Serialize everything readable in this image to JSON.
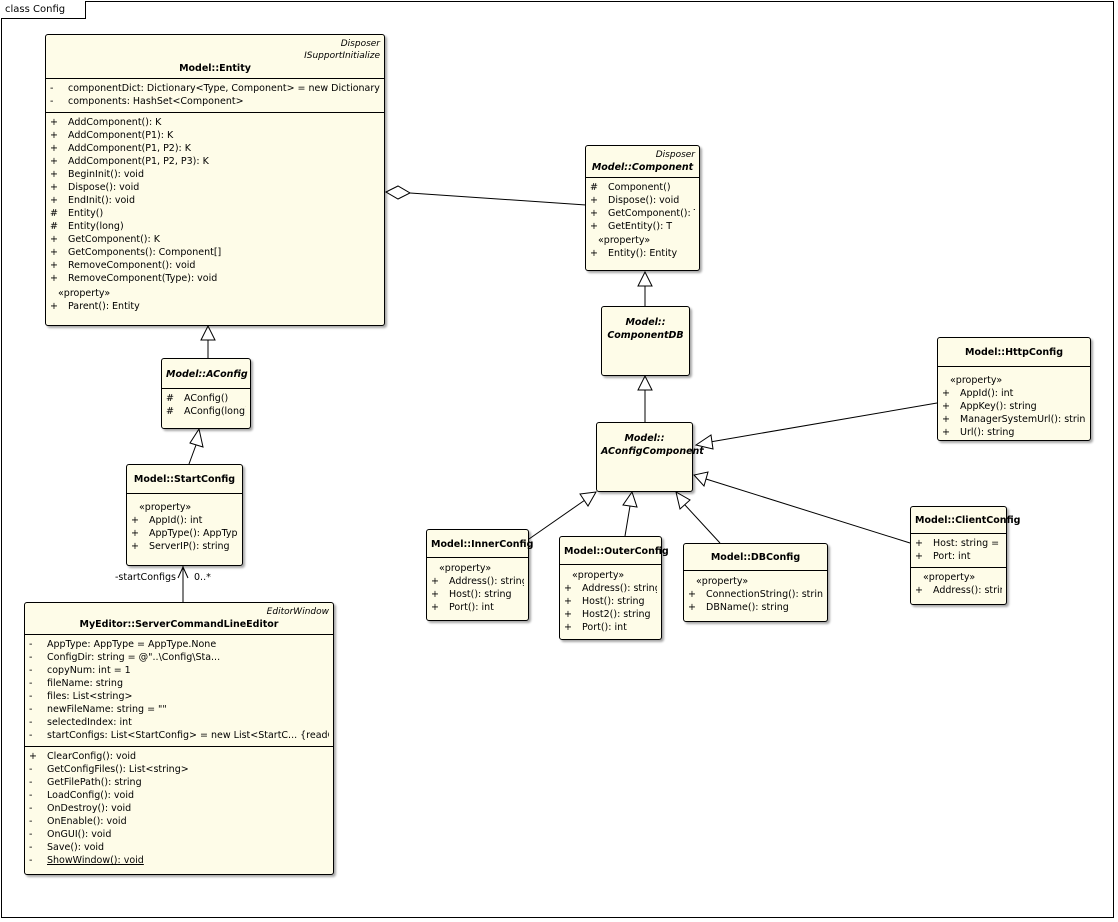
{
  "frame": {
    "label": "class Config"
  },
  "classes": {
    "entity": {
      "stereotypes": [
        "Disposer",
        "ISupportInitialize"
      ],
      "name": "Model::Entity",
      "attributes": [
        {
          "vis": "-",
          "text": "componentDict: Dictionary<Type, Component> = new Dictionary<..."
        },
        {
          "vis": "-",
          "text": "components: HashSet<Component>"
        }
      ],
      "operations": [
        {
          "vis": "+",
          "text": "AddComponent(): K"
        },
        {
          "vis": "+",
          "text": "AddComponent(P1): K"
        },
        {
          "vis": "+",
          "text": "AddComponent(P1, P2): K"
        },
        {
          "vis": "+",
          "text": "AddComponent(P1, P2, P3): K"
        },
        {
          "vis": "+",
          "text": "BeginInit(): void"
        },
        {
          "vis": "+",
          "text": "Dispose(): void"
        },
        {
          "vis": "+",
          "text": "EndInit(): void"
        },
        {
          "vis": "#",
          "text": "Entity()"
        },
        {
          "vis": "#",
          "text": "Entity(long)"
        },
        {
          "vis": "+",
          "text": "GetComponent(): K"
        },
        {
          "vis": "+",
          "text": "GetComponents(): Component[]"
        },
        {
          "vis": "+",
          "text": "RemoveComponent(): void"
        },
        {
          "vis": "+",
          "text": "RemoveComponent(Type): void"
        }
      ],
      "property_label": "«property»",
      "properties": [
        {
          "vis": "+",
          "text": "Parent(): Entity"
        }
      ]
    },
    "component": {
      "stereotypes": [
        "Disposer"
      ],
      "name": "Model::Component",
      "operations": [
        {
          "vis": "#",
          "text": "Component()"
        },
        {
          "vis": "+",
          "text": "Dispose(): void"
        },
        {
          "vis": "+",
          "text": "GetComponent(): T"
        },
        {
          "vis": "+",
          "text": "GetEntity(): T"
        }
      ],
      "property_label": "«property»",
      "properties": [
        {
          "vis": "+",
          "text": "Entity(): Entity"
        }
      ]
    },
    "componentdb": {
      "name_line1": "Model::",
      "name_line2": "ComponentDB"
    },
    "aconfigcomponent": {
      "name_line1": "Model::",
      "name_line2": "AConfigComponent"
    },
    "aconfig": {
      "name": "Model::AConfig",
      "operations": [
        {
          "vis": "#",
          "text": "AConfig()"
        },
        {
          "vis": "#",
          "text": "AConfig(long)"
        }
      ]
    },
    "startconfig": {
      "name": "Model::StartConfig",
      "property_label": "«property»",
      "properties": [
        {
          "vis": "+",
          "text": "AppId(): int"
        },
        {
          "vis": "+",
          "text": "AppType(): AppType"
        },
        {
          "vis": "+",
          "text": "ServerIP(): string"
        }
      ]
    },
    "editor": {
      "stereotypes": [
        "EditorWindow"
      ],
      "name": "MyEditor::ServerCommandLineEditor",
      "attributes": [
        {
          "vis": "-",
          "text": "AppType: AppType = AppType.None"
        },
        {
          "vis": "-",
          "text": "ConfigDir: string = @\"..\\Config\\Sta..."
        },
        {
          "vis": "-",
          "text": "copyNum: int = 1"
        },
        {
          "vis": "-",
          "text": "fileName: string"
        },
        {
          "vis": "-",
          "text": "files: List<string>"
        },
        {
          "vis": "-",
          "text": "newFileName: string = \"\""
        },
        {
          "vis": "-",
          "text": "selectedIndex: int"
        },
        {
          "vis": "-",
          "text": "startConfigs: List<StartConfig> = new List<StartC... {readOnly}"
        }
      ],
      "operations": [
        {
          "vis": "+",
          "text": "ClearConfig(): void"
        },
        {
          "vis": "-",
          "text": "GetConfigFiles(): List<string>"
        },
        {
          "vis": "-",
          "text": "GetFilePath(): string"
        },
        {
          "vis": "-",
          "text": "LoadConfig(): void"
        },
        {
          "vis": "-",
          "text": "OnDestroy(): void"
        },
        {
          "vis": "-",
          "text": "OnEnable(): void"
        },
        {
          "vis": "-",
          "text": "OnGUI(): void"
        },
        {
          "vis": "-",
          "text": "Save(): void"
        },
        {
          "vis": "-",
          "text": "ShowWindow(): void",
          "static": true
        }
      ]
    },
    "httpconfig": {
      "name": "Model::HttpConfig",
      "property_label": "«property»",
      "properties": [
        {
          "vis": "+",
          "text": "AppId(): int"
        },
        {
          "vis": "+",
          "text": "AppKey(): string"
        },
        {
          "vis": "+",
          "text": "ManagerSystemUrl(): string"
        },
        {
          "vis": "+",
          "text": "Url(): string"
        }
      ]
    },
    "innerconfig": {
      "name": "Model::InnerConfig",
      "property_label": "«property»",
      "properties": [
        {
          "vis": "+",
          "text": "Address(): string"
        },
        {
          "vis": "+",
          "text": "Host(): string"
        },
        {
          "vis": "+",
          "text": "Port(): int"
        }
      ]
    },
    "outerconfig": {
      "name": "Model::OuterConfig",
      "property_label": "«property»",
      "properties": [
        {
          "vis": "+",
          "text": "Address(): string"
        },
        {
          "vis": "+",
          "text": "Host(): string"
        },
        {
          "vis": "+",
          "text": "Host2(): string"
        },
        {
          "vis": "+",
          "text": "Port(): int"
        }
      ]
    },
    "dbconfig": {
      "name": "Model::DBConfig",
      "property_label": "«property»",
      "properties": [
        {
          "vis": "+",
          "text": "ConnectionString(): string"
        },
        {
          "vis": "+",
          "text": "DBName(): string"
        }
      ]
    },
    "clientconfig": {
      "name": "Model::ClientConfig",
      "attributes": [
        {
          "vis": "+",
          "text": "Host: string = \"\""
        },
        {
          "vis": "+",
          "text": "Port: int"
        }
      ],
      "property_label": "«property»",
      "properties": [
        {
          "vis": "+",
          "text": "Address(): string"
        }
      ]
    }
  },
  "association": {
    "role": "-startConfigs",
    "multiplicity": "0..*"
  }
}
